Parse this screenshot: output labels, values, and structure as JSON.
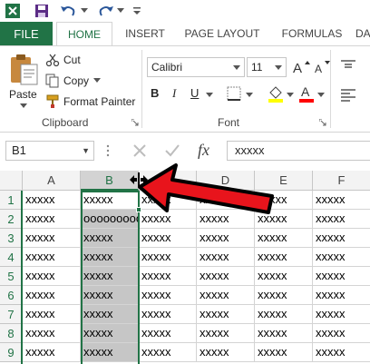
{
  "qat": {
    "icons": [
      "excel-icon",
      "save-icon",
      "undo-icon",
      "redo-icon",
      "customize-qat-icon"
    ]
  },
  "tabs": {
    "file": "FILE",
    "home": "HOME",
    "insert": "INSERT",
    "page_layout": "PAGE LAYOUT",
    "formulas": "FORMULAS",
    "more": "DA"
  },
  "ribbon": {
    "clipboard": {
      "paste": "Paste",
      "cut": "Cut",
      "copy": "Copy",
      "format_painter": "Format Painter",
      "group_label": "Clipboard"
    },
    "font": {
      "font_name": "Calibri",
      "font_size": "11",
      "bold": "B",
      "italic": "I",
      "underline": "U",
      "group_label": "Font",
      "fill_color": "#ffff00",
      "font_color": "#ff0000"
    }
  },
  "formula_bar": {
    "name_box": "B1",
    "fx": "fx",
    "content": "xxxxx"
  },
  "grid": {
    "columns": [
      "A",
      "B",
      "C",
      "D",
      "E",
      "F"
    ],
    "selected_column": "B",
    "rows": [
      {
        "num": "1",
        "cells": [
          "xxxxx",
          "xxxxx",
          "xxxxx",
          "xxxxx",
          "xxxxx",
          "xxxxx"
        ]
      },
      {
        "num": "2",
        "cells": [
          "xxxxx",
          "oooooooooo",
          "xxxxx",
          "xxxxx",
          "xxxxx",
          "xxxxx"
        ]
      },
      {
        "num": "3",
        "cells": [
          "xxxxx",
          "xxxxx",
          "xxxxx",
          "xxxxx",
          "xxxxx",
          "xxxxx"
        ]
      },
      {
        "num": "4",
        "cells": [
          "xxxxx",
          "xxxxx",
          "xxxxx",
          "xxxxx",
          "xxxxx",
          "xxxxx"
        ]
      },
      {
        "num": "5",
        "cells": [
          "xxxxx",
          "xxxxx",
          "xxxxx",
          "xxxxx",
          "xxxxx",
          "xxxxx"
        ]
      },
      {
        "num": "6",
        "cells": [
          "xxxxx",
          "xxxxx",
          "xxxxx",
          "xxxxx",
          "xxxxx",
          "xxxxx"
        ]
      },
      {
        "num": "7",
        "cells": [
          "xxxxx",
          "xxxxx",
          "xxxxx",
          "xxxxx",
          "xxxxx",
          "xxxxx"
        ]
      },
      {
        "num": "8",
        "cells": [
          "xxxxx",
          "xxxxx",
          "xxxxx",
          "xxxxx",
          "xxxxx",
          "xxxxx"
        ]
      },
      {
        "num": "9",
        "cells": [
          "xxxxx",
          "xxxxx",
          "xxxxx",
          "xxxxx",
          "xxxxx",
          "xxxxx"
        ]
      }
    ]
  },
  "colors": {
    "accent": "#217346",
    "arrow": "#e8141c"
  }
}
